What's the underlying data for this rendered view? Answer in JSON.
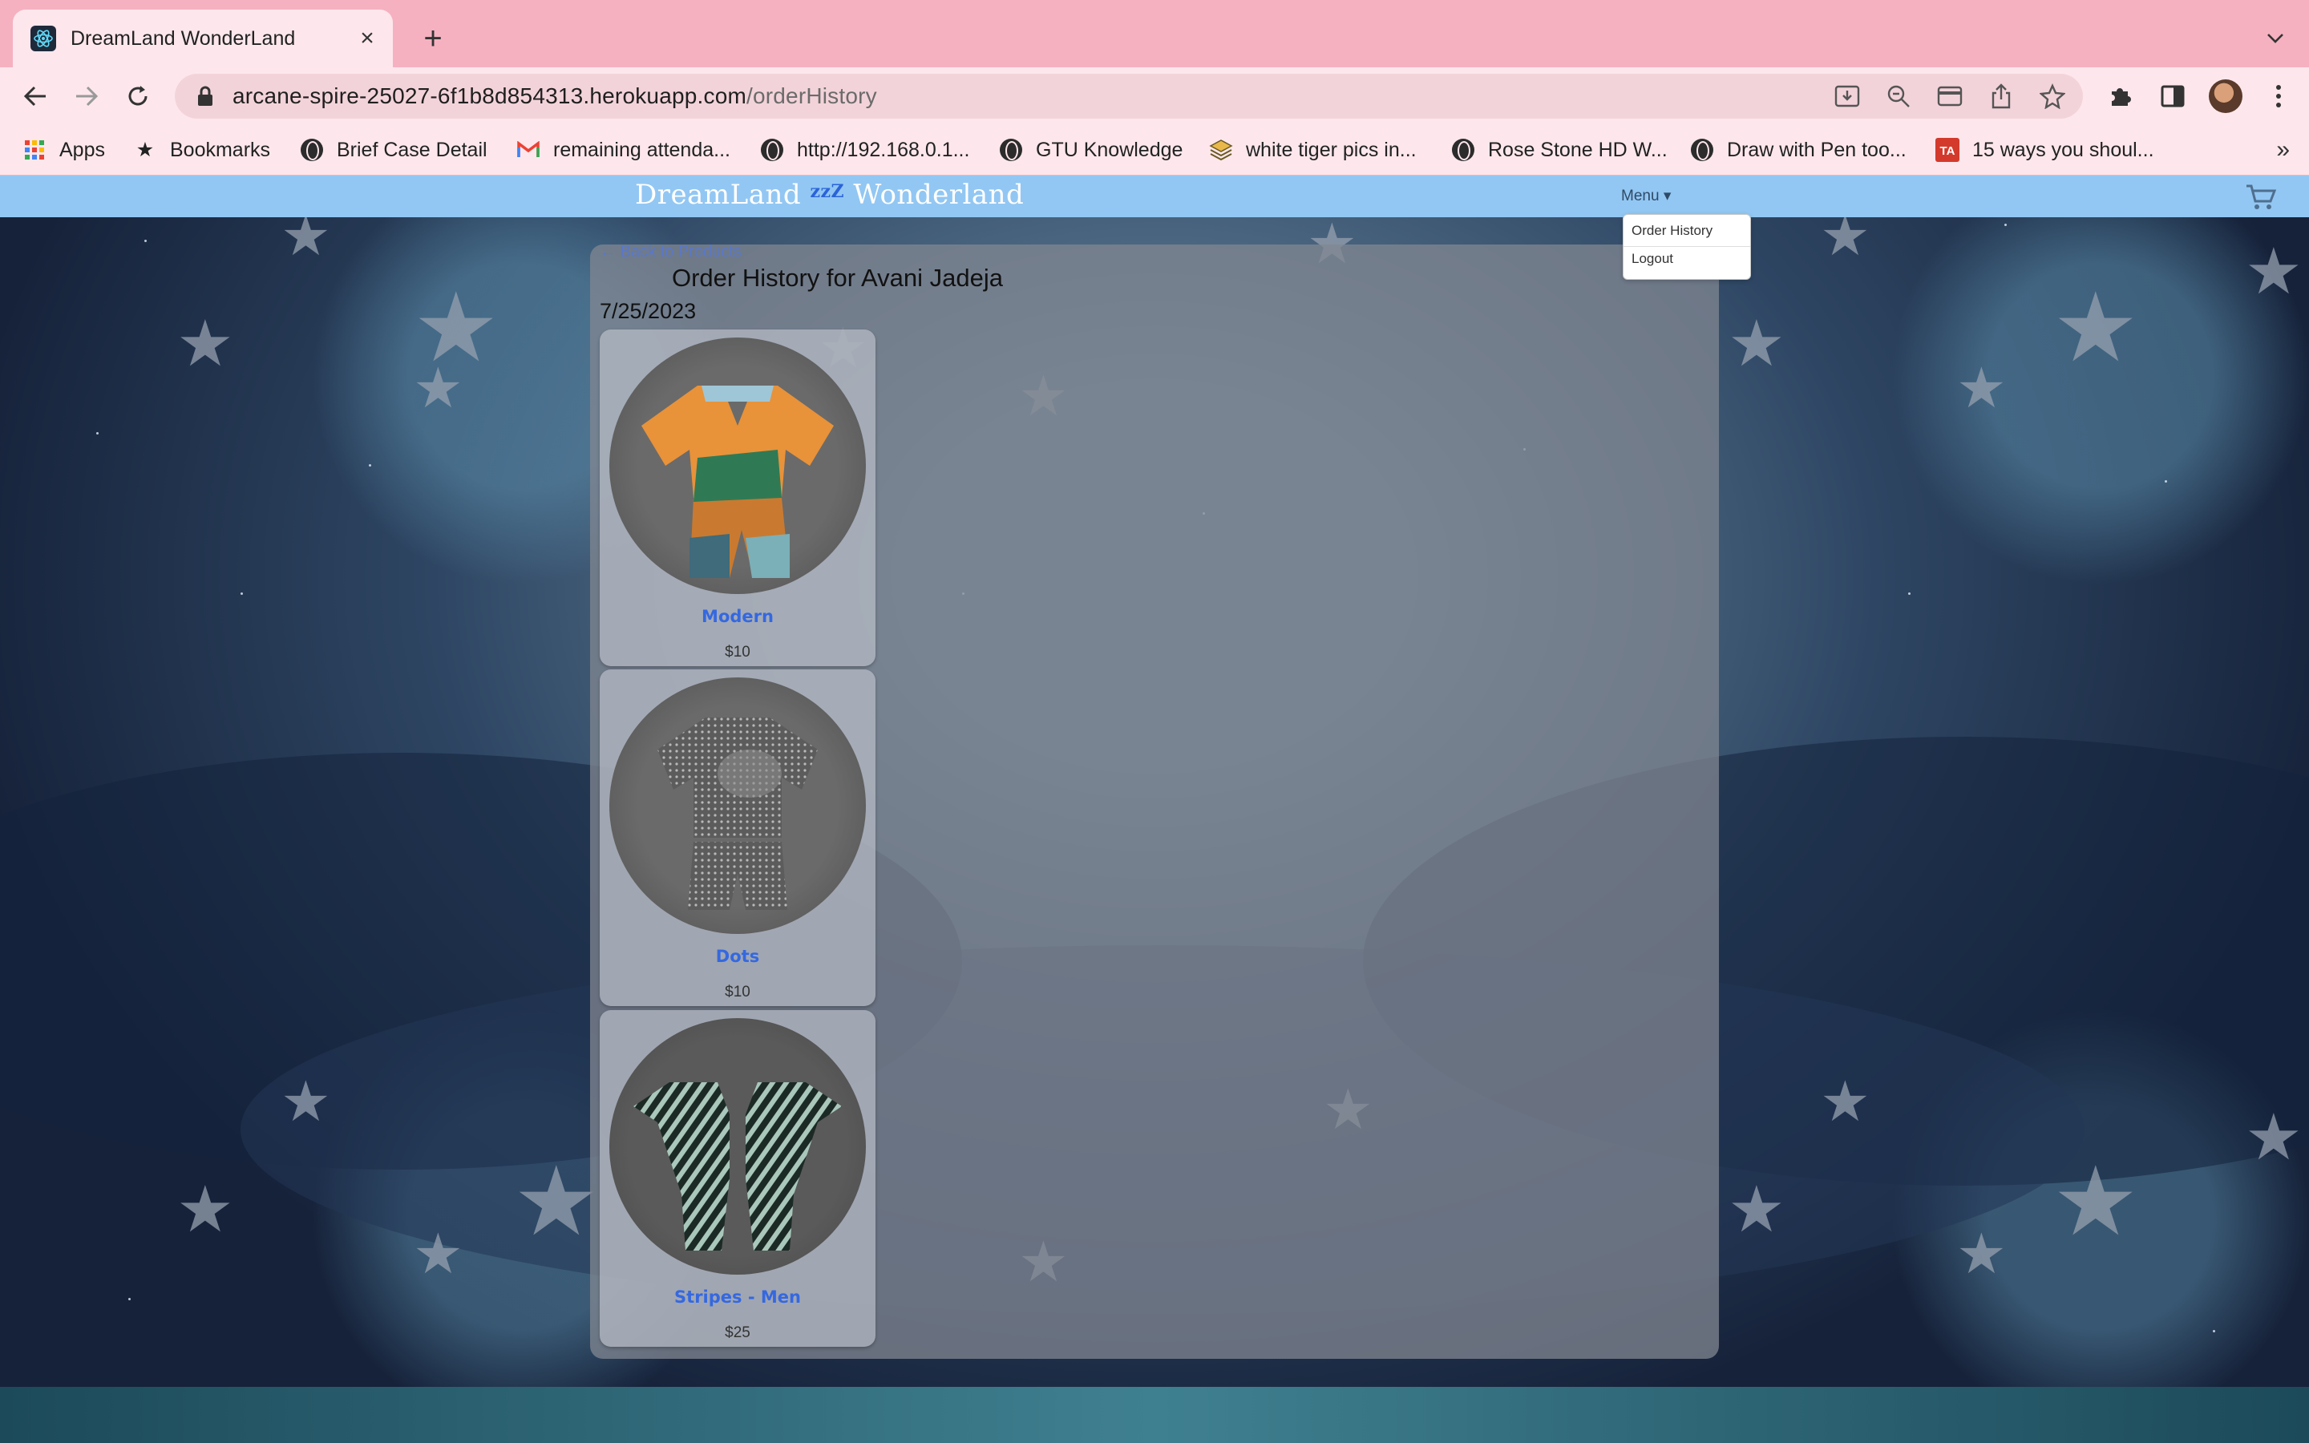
{
  "browser": {
    "tab_title": "DreamLand WonderLand",
    "url_host": "arcane-spire-25027-6f1b8d854313.herokuapp.com",
    "url_path": "/orderHistory",
    "bookmarks": [
      {
        "label": "Apps",
        "icon": "apps-grid-icon"
      },
      {
        "label": "Bookmarks",
        "icon": "star-icon"
      },
      {
        "label": "Brief Case Detail",
        "icon": "globe-icon"
      },
      {
        "label": "remaining attenda...",
        "icon": "gmail-icon"
      },
      {
        "label": "http://192.168.0.1...",
        "icon": "globe-icon"
      },
      {
        "label": "GTU Knowledge",
        "icon": "globe-icon"
      },
      {
        "label": "white tiger pics in...",
        "icon": "layers-icon"
      },
      {
        "label": "Rose Stone HD W...",
        "icon": "globe-icon"
      },
      {
        "label": "Draw with Pen too...",
        "icon": "globe-icon"
      },
      {
        "label": "15 ways you shoul...",
        "icon": "ta-icon"
      }
    ],
    "bookmarks_more": "»"
  },
  "app": {
    "brand_left": "DreamLand",
    "brand_zzz": "zzZ",
    "brand_right": "Wonderland",
    "menu_label": "Menu",
    "menu_items": [
      "Order History",
      "Logout"
    ],
    "back_link": "← Back to Products",
    "order_title": "Order History for Avani Jadeja",
    "order_date": "7/25/2023",
    "products": [
      {
        "name": "Modern",
        "price": "$10"
      },
      {
        "name": "Dots",
        "price": "$10"
      },
      {
        "name": "Stripes - Men",
        "price": "$25"
      }
    ]
  },
  "colors": {
    "tabstrip": "#f5b1c0",
    "navbar": "#92c7f3",
    "product_link": "#3568e0"
  }
}
